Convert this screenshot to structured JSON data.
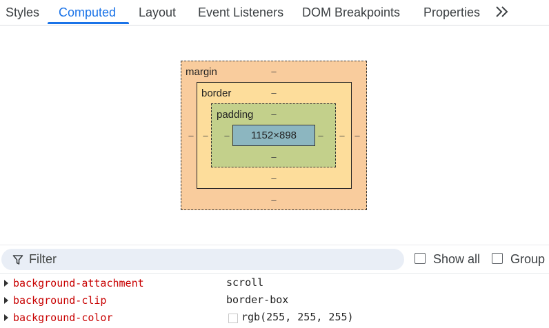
{
  "tabs": [
    {
      "label": "Styles",
      "active": false
    },
    {
      "label": "Computed",
      "active": true
    },
    {
      "label": "Layout",
      "active": false
    },
    {
      "label": "Event Listeners",
      "active": false
    },
    {
      "label": "DOM Breakpoints",
      "active": false
    },
    {
      "label": "Properties",
      "active": false
    }
  ],
  "overflow_icon": "chevron-double-right-icon",
  "box_model": {
    "margin": {
      "label": "margin",
      "top": "–",
      "bottom": "–",
      "left": "–",
      "right": "–"
    },
    "border": {
      "label": "border",
      "top": "–",
      "bottom": "–",
      "left": "–",
      "right": "–"
    },
    "padding": {
      "label": "padding",
      "top": "–",
      "bottom": "–",
      "left": "–",
      "right": "–"
    },
    "content": "1152×898"
  },
  "filter": {
    "placeholder": "Filter",
    "icon": "filter-icon"
  },
  "options": {
    "show_all": "Show all",
    "group": "Group"
  },
  "properties": [
    {
      "name": "background-attachment",
      "value": "scroll"
    },
    {
      "name": "background-clip",
      "value": "border-box"
    },
    {
      "name": "background-color",
      "value": "rgb(255, 255, 255)",
      "swatch": "#ffffff"
    }
  ],
  "colors": {
    "accent": "#1a73e8",
    "margin": "#f9cc9d",
    "border": "#fddd9b",
    "padding": "#c3d08b",
    "content": "#8cb6c0",
    "prop_name": "#c80000"
  }
}
